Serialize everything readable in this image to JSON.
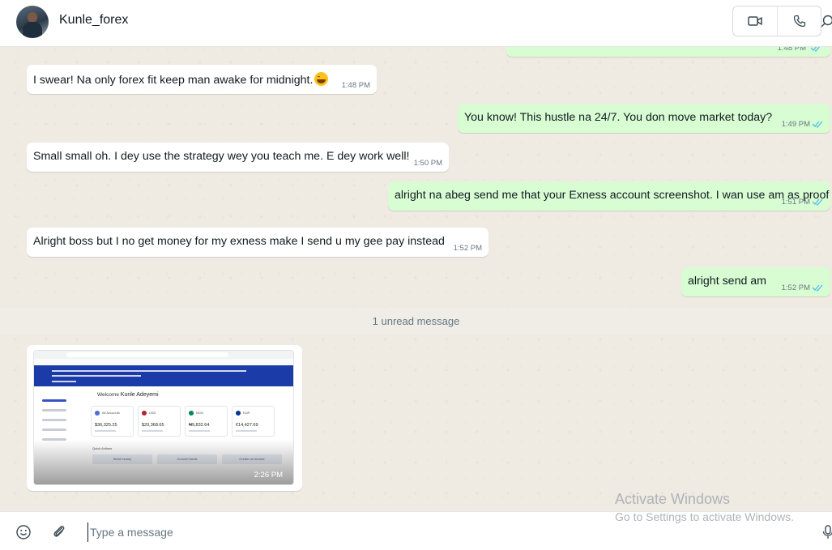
{
  "header": {
    "contact_name": "Kunle_forex",
    "video_icon": "video-camera-icon",
    "call_icon": "phone-icon",
    "search_icon": "search-icon"
  },
  "colors": {
    "incoming_bubble": "#ffffff",
    "outgoing_bubble": "#d9fdd3",
    "read_tick": "#53bdeb",
    "chat_background": "#efeae2"
  },
  "messages": [
    {
      "direction": "incoming",
      "text": "I swear! Na only forex fit keep man awake for midnight.",
      "emoji": "grinning-squinting-face",
      "time": "1:48 PM"
    },
    {
      "direction": "outgoing",
      "text": "You know! This hustle na 24/7. You don move market today?",
      "time": "1:49 PM",
      "status": "read"
    },
    {
      "direction": "incoming",
      "text": "Small small oh. I dey use the strategy wey you teach me. E dey work well!",
      "time": "1:50 PM"
    },
    {
      "direction": "outgoing",
      "text": "alright na abeg send me that your Exness account screenshot. I wan use am as proof",
      "time": "1:51 PM",
      "status": "read"
    },
    {
      "direction": "incoming",
      "text": "Alright boss but I no get money for my exness make I send u my gee pay instead",
      "time": "1:52 PM"
    },
    {
      "direction": "outgoing",
      "text": "alright send am",
      "time": "1:52 PM",
      "status": "read"
    }
  ],
  "unread_divider": "1 unread message",
  "image_message": {
    "time": "2:26 PM",
    "screenshot": {
      "welcome": "Welcome",
      "user_name": "Kunle Adeyemi",
      "accounts": [
        {
          "label": "All Accounts",
          "value": "$36,325.25",
          "color": "#4f6bd8"
        },
        {
          "label": "USD",
          "value": "$20,368.65",
          "color": "#b22234"
        },
        {
          "label": "NGN",
          "value": "₦9,832.64",
          "color": "#008751"
        },
        {
          "label": "EUR",
          "value": "€14,427.69",
          "color": "#003399"
        }
      ],
      "quick_actions_label": "Quick Actions",
      "quick_actions": [
        "Send money",
        "Convert funds",
        "Create an invoice"
      ]
    }
  },
  "watermark": {
    "title": "Activate Windows",
    "subtitle": "Go to Settings to activate Windows."
  },
  "composer": {
    "placeholder": "Type a message",
    "emoji_icon": "smiley-icon",
    "attach_icon": "paperclip-icon",
    "mic_icon": "microphone-icon"
  }
}
